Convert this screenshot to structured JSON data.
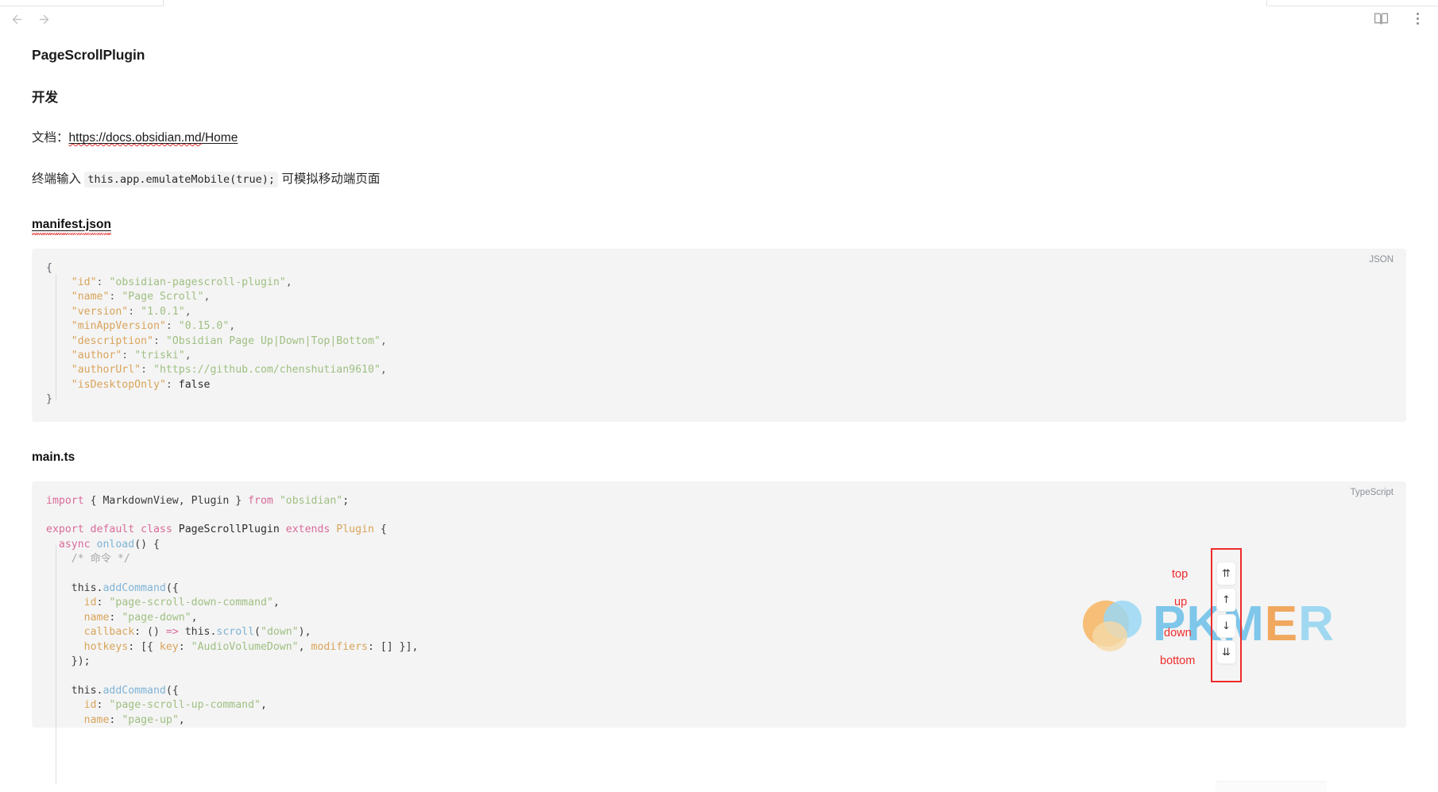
{
  "chrome": {
    "back_icon": "arrow-left-icon",
    "forward_icon": "arrow-right-icon",
    "reading_view_icon": "book-open-icon",
    "more_menu_icon": "more-vertical-icon"
  },
  "document": {
    "title": "PageScrollPlugin",
    "section_heading": "开发",
    "doc_line_prefix": "文档：",
    "doc_link_text": "https://docs.obsidian.md",
    "doc_link_suffix": "/Home",
    "terminal_line_prefix": "终端输入 ",
    "terminal_code": "this.app.emulateMobile(true);",
    "terminal_line_suffix": " 可模拟移动端页面",
    "manifest_heading": "manifest.json",
    "main_heading": "main.ts"
  },
  "code_blocks": [
    {
      "lang_label": "JSON",
      "lines": [
        "{",
        "    \"id\": \"obsidian-pagescroll-plugin\",",
        "    \"name\": \"Page Scroll\",",
        "    \"version\": \"1.0.1\",",
        "    \"minAppVersion\": \"0.15.0\",",
        "    \"description\": \"Obsidian Page Up|Down|Top|Bottom\",",
        "    \"author\": \"triski\",",
        "    \"authorUrl\": \"https://github.com/chenshutian9610\",",
        "    \"isDesktopOnly\": false",
        "}"
      ],
      "fields": {
        "id": "obsidian-pagescroll-plugin",
        "name": "Page Scroll",
        "version": "1.0.1",
        "minAppVersion": "0.15.0",
        "description": "Obsidian Page Up|Down|Top|Bottom",
        "author": "triski",
        "authorUrl": "https://github.com/chenshutian9610",
        "isDesktopOnly": "false"
      }
    },
    {
      "lang_label": "TypeScript",
      "lines": [
        "import { MarkdownView, Plugin } from \"obsidian\";",
        "",
        "export default class PageScrollPlugin extends Plugin {",
        "  async onload() {",
        "    /* 命令 */",
        "",
        "    this.addCommand({",
        "      id: \"page-scroll-down-command\",",
        "      name: \"page-down\",",
        "      callback: () => this.scroll(\"down\"),",
        "      hotkeys: [{ key: \"AudioVolumeDown\", modifiers: [] }],",
        "    });",
        "",
        "    this.addCommand({",
        "      id: \"page-scroll-up-command\","
      ]
    }
  ],
  "watermark": {
    "text_p": "P",
    "text_k": "K",
    "text_m": "M",
    "text_e": "E",
    "text_r": "R"
  },
  "scroll_controls": {
    "labels": {
      "top": "top",
      "up": "up",
      "down": "down",
      "bottom": "bottom"
    },
    "buttons": [
      {
        "name": "scroll-to-top-button",
        "glyph": "⇈"
      },
      {
        "name": "scroll-up-button",
        "glyph": "↑"
      },
      {
        "name": "scroll-down-button",
        "glyph": "↓"
      },
      {
        "name": "scroll-to-bottom-button",
        "glyph": "⇊"
      }
    ],
    "highlight_color": "#ef2b2b"
  }
}
